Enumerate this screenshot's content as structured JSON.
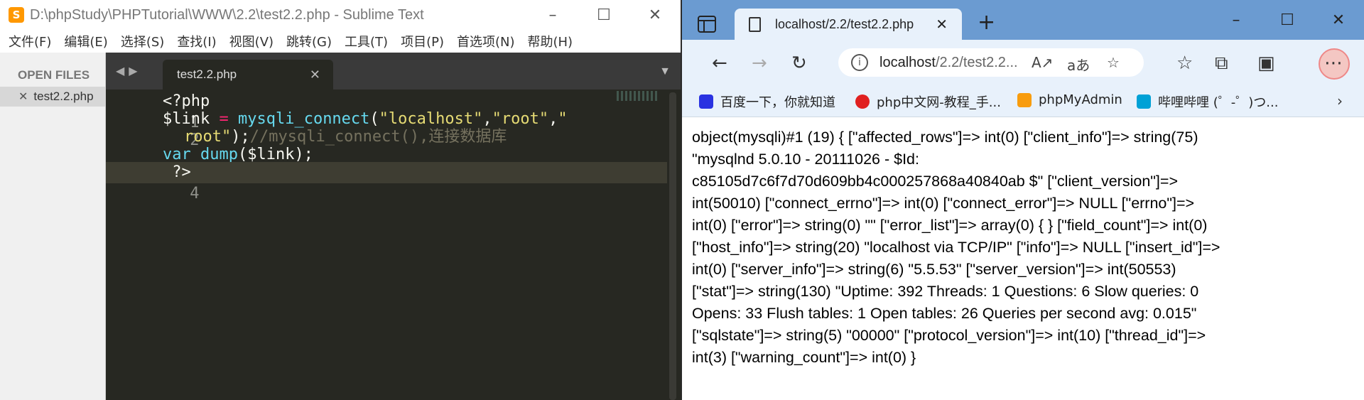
{
  "sublime": {
    "title": "D:\\phpStudy\\PHPTutorial\\WWW\\2.2\\test2.2.php - Sublime Text",
    "app_icon": "S",
    "menu": [
      "文件(F)",
      "编辑(E)",
      "选择(S)",
      "查找(I)",
      "视图(V)",
      "跳转(G)",
      "工具(T)",
      "项目(P)",
      "首选项(N)",
      "帮助(H)"
    ],
    "sidebar": {
      "header": "OPEN FILES",
      "file": "test2.2.php"
    },
    "tab": {
      "label": "test2.2.php"
    },
    "line_numbers": [
      "1",
      "2",
      "3",
      "4"
    ],
    "code": {
      "l1": "<?php",
      "l2_var": "$link",
      "l2_eq": " = ",
      "l2_fn": "mysqli_connect",
      "l2_p1": "(",
      "l2_s1": "\"localhost\"",
      "l2_c1": ",",
      "l2_s2": "\"root\"",
      "l2_c2": ",",
      "l2_s3a": "\"",
      "l2_s3b": "root\"",
      "l2_p2": ");",
      "l2_cmt": "//mysqli_connect(),连接数据库",
      "l3_fn": "var_dump",
      "l3_rest": "($link);",
      "l4": " ?>"
    },
    "colors": {
      "background": "#272822",
      "keyword": "#f92672",
      "function": "#66d9ef",
      "string": "#e6db74",
      "comment": "#75715e"
    }
  },
  "edge": {
    "tab_title": "localhost/2.2/test2.2.php",
    "address": {
      "host": "localhost",
      "path": "/2.2/test2.2..."
    },
    "favorites": [
      {
        "label": "百度一下，你就知道",
        "icon": "baidu-icon",
        "color": "#2932e1"
      },
      {
        "label": "php中文网-教程_手...",
        "icon": "php-cn-icon",
        "color": "#e02020"
      },
      {
        "label": "phpMyAdmin",
        "icon": "phpmyadmin-icon",
        "color": "#f89c0e"
      },
      {
        "label": "哔哩哔哩 (゜-゜)つ...",
        "icon": "bilibili-icon",
        "color": "#00a1d6"
      }
    ],
    "output_lines": [
      "object(mysqli)#1 (19) { [\"affected_rows\"]=> int(0) [\"client_info\"]=> string(75)",
      "\"mysqlnd 5.0.10 - 20111026 - $Id:",
      "c85105d7c6f7d70d609bb4c000257868a40840ab $\" [\"client_version\"]=>",
      "int(50010) [\"connect_errno\"]=> int(0) [\"connect_error\"]=> NULL [\"errno\"]=>",
      "int(0) [\"error\"]=> string(0) \"\" [\"error_list\"]=> array(0) { } [\"field_count\"]=> int(0)",
      "[\"host_info\"]=> string(20) \"localhost via TCP/IP\" [\"info\"]=> NULL [\"insert_id\"]=>",
      "int(0) [\"server_info\"]=> string(6) \"5.5.53\" [\"server_version\"]=> int(50553)",
      "[\"stat\"]=> string(130) \"Uptime: 392 Threads: 1 Questions: 6 Slow queries: 0",
      "Opens: 33 Flush tables: 1 Open tables: 26 Queries per second avg: 0.015\"",
      "[\"sqlstate\"]=> string(5) \"00000\" [\"protocol_version\"]=> int(10) [\"thread_id\"]=>",
      "int(3) [\"warning_count\"]=> int(0) }"
    ]
  }
}
